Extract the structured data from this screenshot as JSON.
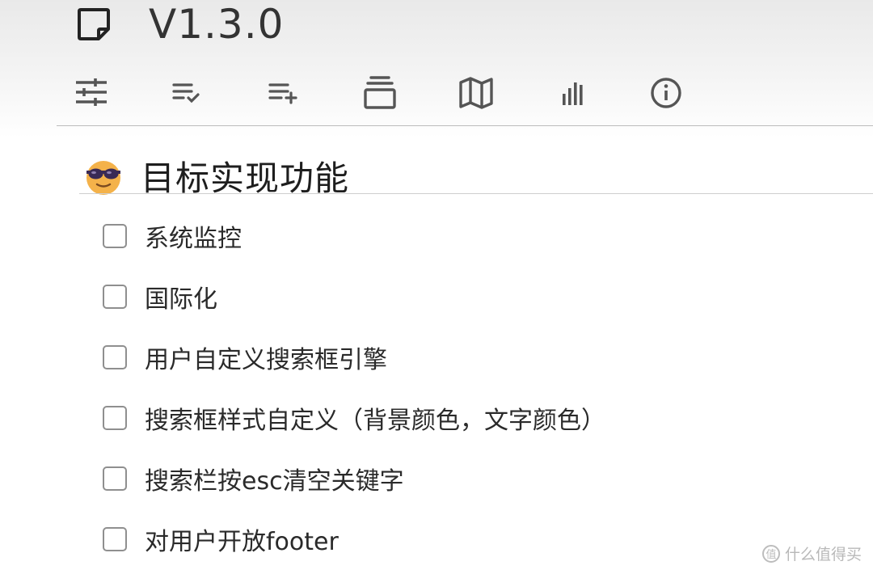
{
  "header": {
    "version": "V1.3.0",
    "icon": "sticky-note-icon"
  },
  "toolbar": {
    "items": [
      {
        "icon": "sliders-icon"
      },
      {
        "icon": "list-check-icon"
      },
      {
        "icon": "list-add-icon"
      },
      {
        "icon": "panel-icon"
      },
      {
        "icon": "map-icon"
      },
      {
        "icon": "bar-chart-icon"
      },
      {
        "icon": "info-icon"
      }
    ]
  },
  "section": {
    "emoji": "cool-face-emoji-icon",
    "title": "目标实现功能"
  },
  "checklist": {
    "items": [
      {
        "label": "系统监控",
        "checked": false
      },
      {
        "label": "国际化",
        "checked": false
      },
      {
        "label": "用户自定义搜索框引擎",
        "checked": false
      },
      {
        "label": "搜索框样式自定义（背景颜色，文字颜色）",
        "checked": false
      },
      {
        "label": "搜索栏按esc清空关键字",
        "checked": false
      },
      {
        "label": "对用户开放footer",
        "checked": false
      }
    ]
  },
  "watermark": {
    "text": "什么值得买",
    "icon_text": "值"
  }
}
